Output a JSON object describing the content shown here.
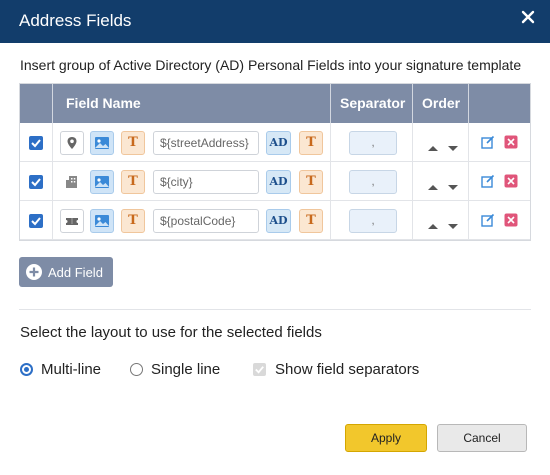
{
  "dialog": {
    "title": "Address Fields",
    "close_icon": "close-icon",
    "header_bg": "#123d6b"
  },
  "intro_text": "Insert group of Active Directory (AD) Personal Fields into your signature template",
  "table": {
    "columns": [
      "Field Name",
      "Separator",
      "Order"
    ],
    "rows": [
      {
        "checked": true,
        "type_icon": "location-pin-icon",
        "placeholder": "${streetAddress}",
        "separator": ",",
        "image_icon": "image-icon",
        "text_label": "T",
        "ad_label": "AD",
        "t2_label": "T"
      },
      {
        "checked": true,
        "type_icon": "building-icon",
        "placeholder": "${city}",
        "separator": ",",
        "image_icon": "image-icon",
        "text_label": "T",
        "ad_label": "AD",
        "t2_label": "T"
      },
      {
        "checked": true,
        "type_icon": "ticket-icon",
        "placeholder": "${postalCode}",
        "separator": ",",
        "image_icon": "image-icon",
        "text_label": "T",
        "ad_label": "AD",
        "t2_label": "T"
      }
    ]
  },
  "add_field_label": "Add Field",
  "layout": {
    "label": "Select the layout to use for the selected fields",
    "options": [
      "Multi-line",
      "Single line"
    ],
    "selected": "Multi-line",
    "show_separators_label": "Show field separators",
    "show_separators_checked": true,
    "show_separators_disabled": true
  },
  "buttons": {
    "apply": "Apply",
    "cancel": "Cancel"
  },
  "colors": {
    "accent": "#2d6fc6",
    "table_header": "#7e8ca6",
    "apply": "#f2c72c",
    "delete": "#e0557a"
  }
}
